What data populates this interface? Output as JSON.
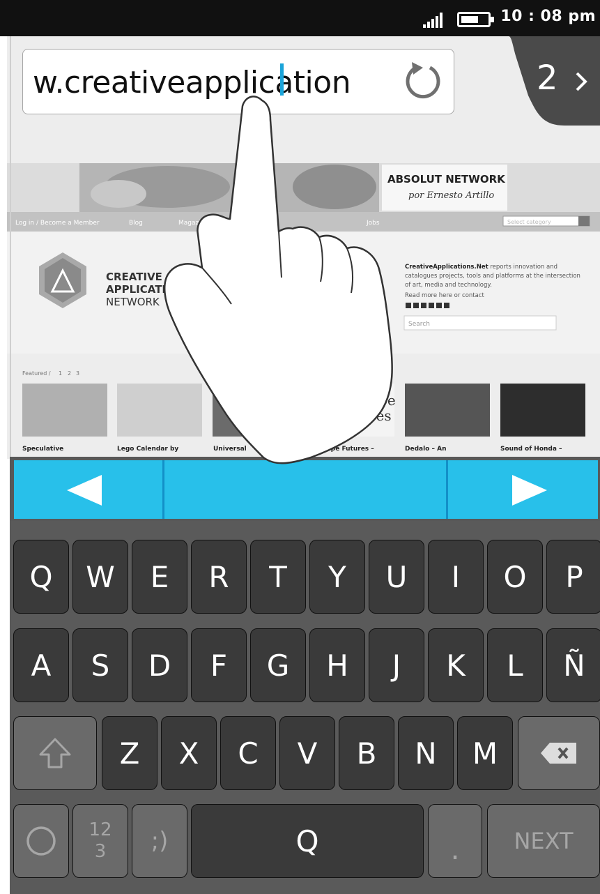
{
  "status_bar": {
    "time": "10 : 08 pm"
  },
  "browser": {
    "url_text": "w.creativeapplication",
    "tab_count": "2"
  },
  "keyboard": {
    "row1": [
      "Q",
      "W",
      "E",
      "R",
      "T",
      "Y",
      "U",
      "I",
      "O",
      "P"
    ],
    "row2": [
      "A",
      "S",
      "D",
      "F",
      "G",
      "H",
      "J",
      "K",
      "L",
      "Ñ"
    ],
    "row3": [
      "Z",
      "X",
      "C",
      "V",
      "B",
      "N",
      "M"
    ],
    "symbols_key_line1": "12",
    "symbols_key_line2": "3",
    "emoji_key": ";)",
    "space_key": "Q",
    "period_key": ".",
    "next_key": "NEXT"
  },
  "website": {
    "banner_title": "ABSOLUT NETWORK",
    "banner_sub": "por Ernesto Artillo",
    "menu": [
      "Log in / Become a Member",
      "Blog",
      "Magazine",
      "Jobs",
      "Select category"
    ],
    "logo_line1": "CREATIVE",
    "logo_line2": "APPLICATI",
    "logo_line3": "NETWORK",
    "about_brand": "CreativeApplications.Net",
    "about_line1": " reports innovation and",
    "about_line2": "catalogues projects, tools and platforms at the intersection",
    "about_line3": "of art, media and technology.",
    "about_line4": "Read more here or contact",
    "search_placeholder": "Search",
    "featured_label": "Featured /",
    "featured_pages": [
      "1",
      "2",
      "3"
    ],
    "captions": [
      "Speculative",
      "Lego Calendar by",
      "Universal",
      "scape Futures –",
      "Dedalo – An",
      "Sound of Honda –"
    ],
    "thumb_text_1": "cape",
    "thumb_text_2": "res"
  },
  "colors": {
    "accent": "#28c0ea",
    "cursor": "#1ba4d9",
    "keyboard_bg": "#5a5a5a",
    "key_dark": "#3a3a3a"
  }
}
